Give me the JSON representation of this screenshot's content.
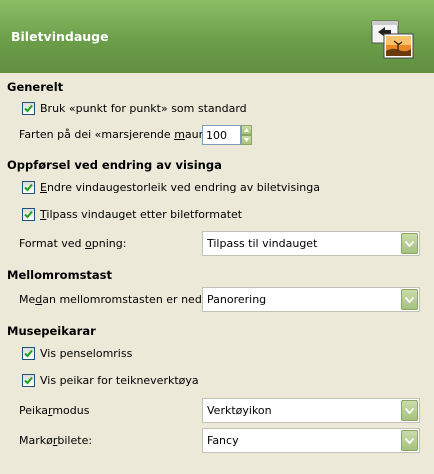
{
  "header": {
    "title": "Biletvindauge",
    "icon": "image-window-prefs-icon"
  },
  "sections": {
    "general": "Generelt",
    "zoom": "Oppførsel ved endring av visinga",
    "space": "Mellomromstast",
    "pointer": "Musepeikarar"
  },
  "general": {
    "dot_for_dot": {
      "label": "Bruk «punkt for punkt» som standard",
      "checked": true
    },
    "ants_speed": {
      "label_pre": "Farten på dei «marsjerende ",
      "label_u": "m",
      "label_post": "aura»:",
      "value": "100"
    }
  },
  "zoom": {
    "resize_window": {
      "label_u": "E",
      "label_post": "ndre vindaugestorleik ved endring av biletvisinga",
      "checked": true
    },
    "fit_window": {
      "label_u": "T",
      "label_post": "ilpass vindauget etter biletformatet",
      "checked": true
    },
    "open_format": {
      "label_pre": "Format ved ",
      "label_u": "o",
      "label_post": "pning:",
      "value": "Tilpass til vindauget"
    }
  },
  "space": {
    "space_action": {
      "label_pre": "Me",
      "label_u": "d",
      "label_post": "an mellomromstasten er nede:",
      "value": "Panorering"
    }
  },
  "pointer": {
    "brush_outline": {
      "label": "Vis penselomriss",
      "checked": true
    },
    "paint_pointer": {
      "label": "Vis peikar for teikneverktøya",
      "checked": true
    },
    "pointer_mode": {
      "label_pre": "Peika",
      "label_u": "r",
      "label_post": "modus",
      "value": "Verktøyikon"
    },
    "pointer_render": {
      "label_pre": "Markø",
      "label_u": "r",
      "label_post": "bilete:",
      "value": "Fancy"
    }
  },
  "colors": {
    "header_green": "#6c9e4a",
    "background": "#ece9d8",
    "check_green": "#21a121"
  }
}
